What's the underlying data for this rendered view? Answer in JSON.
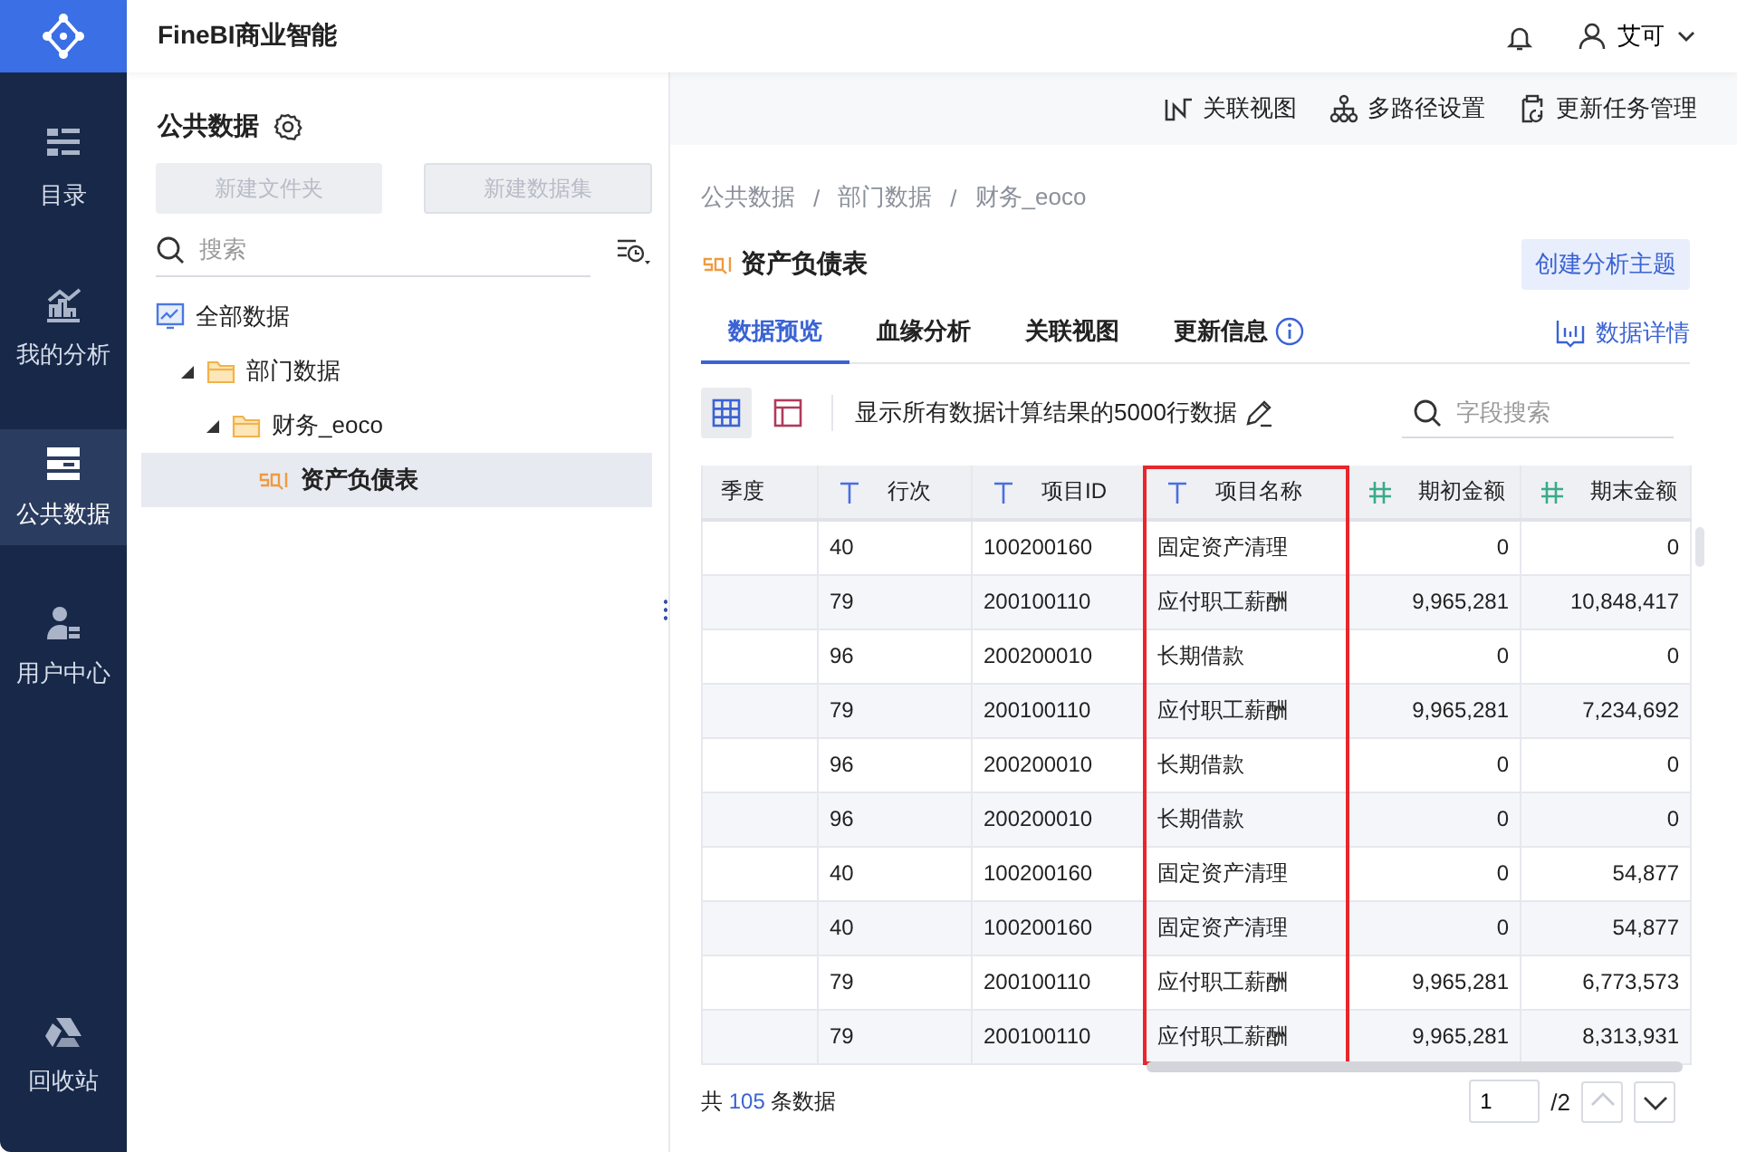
{
  "app": {
    "title": "FineBI商业智能",
    "user": "艾可"
  },
  "nav": [
    {
      "label": "目录",
      "selected": false
    },
    {
      "label": "我的分析",
      "selected": false
    },
    {
      "label": "公共数据",
      "selected": true
    },
    {
      "label": "用户中心",
      "selected": false
    }
  ],
  "nav_bottom": {
    "label": "回收站"
  },
  "panel": {
    "title": "公共数据",
    "buttons": [
      {
        "label": "新建文件夹",
        "disabled": true
      },
      {
        "label": "新建数据集",
        "disabled": true
      }
    ],
    "search": {
      "placeholder": "搜索"
    },
    "tree": [
      {
        "label": "全部数据",
        "kind": "root",
        "selected": false,
        "children": [
          {
            "label": "部门数据",
            "kind": "folder",
            "expanded": true,
            "selected": false,
            "children": [
              {
                "label": "财务_eoco",
                "kind": "folder",
                "expanded": true,
                "selected": false,
                "children": [
                  {
                    "label": "资产负债表",
                    "kind": "table",
                    "selected": true
                  }
                ]
              }
            ]
          }
        ]
      }
    ]
  },
  "toolbar": [
    "关联视图",
    "多路径设置",
    "更新任务管理"
  ],
  "breadcrumb": {
    "items": [
      "公共数据",
      "部门数据",
      "财务_eoco"
    ],
    "separator": "/"
  },
  "dataset": {
    "title": "资产负债表",
    "action": "创建分析主题"
  },
  "tabs": [
    {
      "label": "数据预览",
      "selected": true,
      "info": false
    },
    {
      "label": "血缘分析",
      "selected": false,
      "info": false
    },
    {
      "label": "关联视图",
      "selected": false,
      "info": false
    },
    {
      "label": "更新信息",
      "selected": false,
      "info": true
    }
  ],
  "details_link": "数据详情",
  "view_modes": [
    {
      "selected": true
    },
    {
      "selected": false
    }
  ],
  "row_limit_text": "显示所有数据计算结果的5000行数据",
  "field_search": {
    "placeholder": "字段搜索"
  },
  "table": {
    "columns": [
      {
        "label": "季度",
        "kind": "plain",
        "highlighted": false
      },
      {
        "label": "行次",
        "kind": "text",
        "highlighted": false
      },
      {
        "label": "项目ID",
        "kind": "text",
        "highlighted": false
      },
      {
        "label": "项目名称",
        "kind": "text",
        "highlighted": true
      },
      {
        "label": "期初金额",
        "kind": "number",
        "highlighted": false
      },
      {
        "label": "期末金额",
        "kind": "number",
        "highlighted": false
      }
    ],
    "rows": [
      [
        "",
        "40",
        "100200160",
        "固定资产清理",
        "0",
        "0"
      ],
      [
        "",
        "79",
        "200100110",
        "应付职工薪酬",
        "9,965,281",
        "10,848,417"
      ],
      [
        "",
        "96",
        "200200010",
        "长期借款",
        "0",
        "0"
      ],
      [
        "",
        "79",
        "200100110",
        "应付职工薪酬",
        "9,965,281",
        "7,234,692"
      ],
      [
        "",
        "96",
        "200200010",
        "长期借款",
        "0",
        "0"
      ],
      [
        "",
        "96",
        "200200010",
        "长期借款",
        "0",
        "0"
      ],
      [
        "",
        "40",
        "100200160",
        "固定资产清理",
        "0",
        "54,877"
      ],
      [
        "",
        "40",
        "100200160",
        "固定资产清理",
        "0",
        "54,877"
      ],
      [
        "",
        "79",
        "200100110",
        "应付职工薪酬",
        "9,965,281",
        "6,773,573"
      ],
      [
        "",
        "79",
        "200100110",
        "应付职工薪酬",
        "9,965,281",
        "8,313,931"
      ]
    ]
  },
  "footer": {
    "total_prefix": "共",
    "total": "105",
    "total_suffix": "条数据",
    "page": "1",
    "pages": "/2",
    "prev_disabled": true,
    "next_disabled": false
  }
}
